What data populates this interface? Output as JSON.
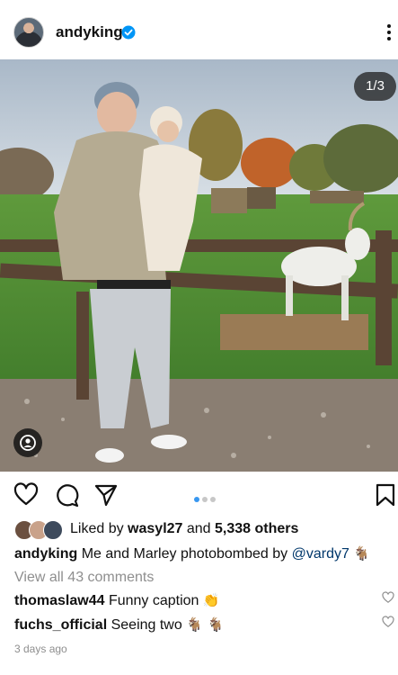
{
  "header": {
    "username": "andyking",
    "verified_icon": "verified-badge-icon",
    "more_icon": "more-options-icon"
  },
  "photo": {
    "counter": "1/3",
    "tag_icon": "user-tag-icon"
  },
  "actions": {
    "icons": [
      "heart-icon",
      "comment-icon",
      "share-icon",
      "bookmark-icon"
    ],
    "carousel_dots": 3,
    "active_dot": 1
  },
  "likes": {
    "prefix": "Liked by ",
    "user": "wasyl27",
    "middle": " and ",
    "others": "5,338 others"
  },
  "caption": {
    "username": "andyking",
    "text": "Me and Marley photobombed by ",
    "mention": "@vardy7",
    "emoji": "🐐"
  },
  "view_comments": "View all 43 comments",
  "comments": [
    {
      "username": "thomaslaw44",
      "text": "Funny caption ",
      "emoji": "👏"
    },
    {
      "username": "fuchs_official",
      "text": "Seeing two ",
      "emoji": "🐐 🐐"
    }
  ],
  "timestamp": "3 days ago",
  "colors": {
    "link": "#00376b",
    "muted": "#8e8e8e",
    "accent": "#3897f0",
    "verified": "#0095f6"
  }
}
